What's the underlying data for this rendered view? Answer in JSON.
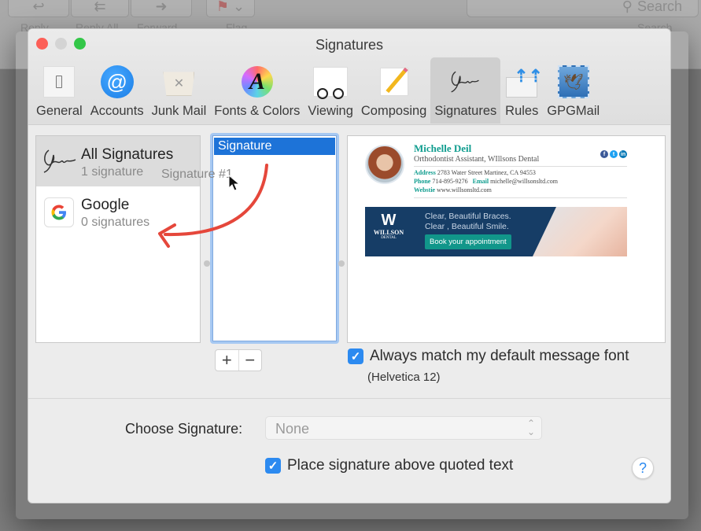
{
  "background_app": {
    "toolbar_buttons": [
      "Reply",
      "Reply All",
      "Forward",
      "Flag"
    ],
    "search_placeholder": "Search",
    "search_label": "Search"
  },
  "window": {
    "title": "Signatures",
    "tabs": [
      {
        "label": "General",
        "icon": "general-switch-icon"
      },
      {
        "label": "Accounts",
        "icon": "at-sign-icon"
      },
      {
        "label": "Junk Mail",
        "icon": "junk-basket-icon"
      },
      {
        "label": "Fonts & Colors",
        "icon": "fonts-color-wheel-icon"
      },
      {
        "label": "Viewing",
        "icon": "glasses-icon"
      },
      {
        "label": "Composing",
        "icon": "pencil-icon"
      },
      {
        "label": "Signatures",
        "icon": "signature-icon",
        "active": true
      },
      {
        "label": "Rules",
        "icon": "rules-envelope-icon"
      },
      {
        "label": "GPGMail",
        "icon": "gpgmail-stamp-icon"
      }
    ]
  },
  "accounts": [
    {
      "name": "All Signatures",
      "count": "1 signature",
      "selected": true
    },
    {
      "name": "Google",
      "count": "0 signatures",
      "selected": false
    }
  ],
  "drag_ghost": "Signature #1",
  "signatures_list": [
    {
      "label": "Signature",
      "selected": true
    }
  ],
  "signature_preview": {
    "name": "Michelle Deil",
    "role": "Orthodontist Assistant, WIllsons Dental",
    "address_label": "Address",
    "address": "2783 Water Street Martinez, CA 94553",
    "phone_label": "Phone",
    "phone": "714-895-9276",
    "email_label": "Email",
    "email": "michelle@willsonsltd.com",
    "website_label": "Webstie",
    "website": "www.willsonsltd.com",
    "social": [
      "f",
      "t",
      "in"
    ],
    "social_colors": [
      "#3b5998",
      "#1da1f2",
      "#0077b5"
    ],
    "banner": {
      "logo_name": "WILLSON",
      "logo_sub": "DENTAL",
      "line1": "Clear, Beautiful Braces.",
      "line2": "Clear , Beautiful Smile.",
      "cta": "Book your appointment"
    }
  },
  "buttons": {
    "add": "+",
    "remove": "−",
    "help": "?"
  },
  "options": {
    "match_font_label": "Always match my default message font",
    "match_font_checked": true,
    "match_font_sub": "(Helvetica 12)",
    "choose_signature_label": "Choose Signature:",
    "choose_signature_value": "None",
    "place_above_label": "Place signature above quoted text",
    "place_above_checked": true
  },
  "colors": {
    "accent": "#2c8af0",
    "selection": "#1d73d8",
    "signature_teal": "#109d8f",
    "banner_navy": "#163d66",
    "annotation_arrow": "#e5473b"
  }
}
